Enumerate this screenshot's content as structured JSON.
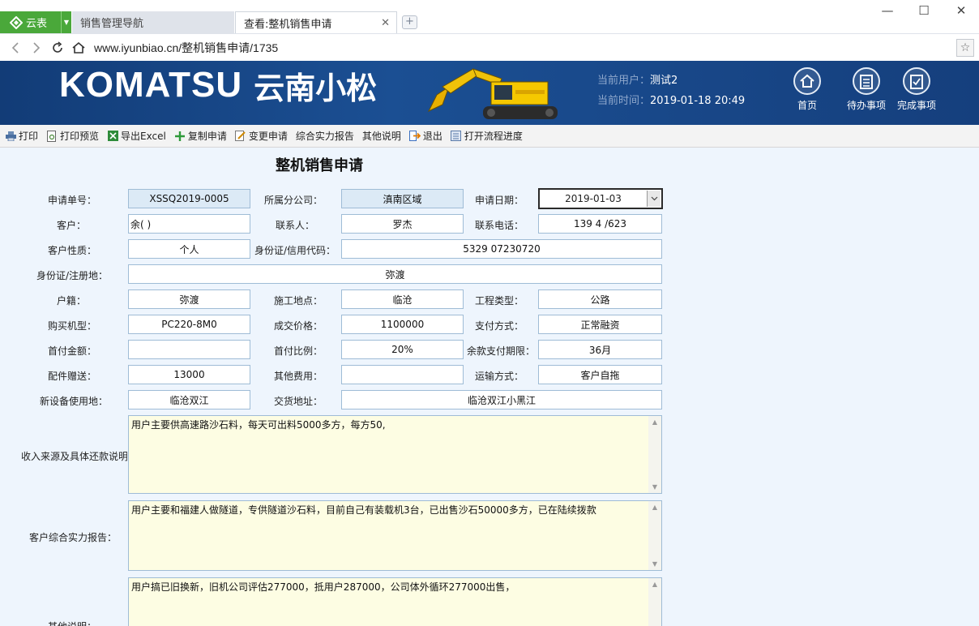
{
  "browser": {
    "app_tab_label": "云表",
    "tabs": [
      {
        "label": "销售管理导航"
      },
      {
        "label": "查看:整机销售申请"
      }
    ],
    "url": "www.iyunbiao.cn/整机销售申请/1735"
  },
  "header": {
    "brand_en": "KOMATSU",
    "brand_cn": "云南小松",
    "current_user_label": "当前用户：",
    "current_user": "测试2",
    "current_time_label": "当前时间：",
    "current_time": "2019-01-18 20:49",
    "nav": [
      {
        "label": "首页"
      },
      {
        "label": "待办事项"
      },
      {
        "label": "完成事项"
      }
    ]
  },
  "toolbar": {
    "print": "打印",
    "print_preview": "打印预览",
    "export_excel": "导出Excel",
    "copy_request": "复制申请",
    "change_request": "变更申请",
    "strength_report": "综合实力报告",
    "other_notes": "其他说明",
    "exit": "退出",
    "open_progress": "打开流程进度"
  },
  "form": {
    "title": "整机销售申请",
    "labels": {
      "request_no": "申请单号：",
      "branch": "所属分公司：",
      "request_date": "申请日期：",
      "customer": "客户：",
      "contact": "联系人：",
      "phone": "联系电话：",
      "customer_type": "客户性质：",
      "id_code": "身份证/信用代码：",
      "reg_addr": "身份证/注册地：",
      "household": "户籍：",
      "site": "施工地点：",
      "project_type": "工程类型：",
      "model": "购买机型：",
      "price": "成交价格：",
      "payment": "支付方式：",
      "down_amount": "首付金额：",
      "down_ratio": "首付比例：",
      "balance_term": "余款支付期限：",
      "parts_gift": "配件赠送：",
      "other_fee": "其他费用：",
      "transport": "运输方式：",
      "use_place": "新设备使用地：",
      "delivery": "交货地址：",
      "income_desc": "收入来源及具体还款说明",
      "strength": "客户综合实力报告：",
      "other": "其他说明："
    },
    "values": {
      "request_no": "XSSQ2019-0005",
      "branch": "滇南区域",
      "request_date": "2019-01-03",
      "customer": "余(   )",
      "contact": "罗杰",
      "phone": "139      4 /623",
      "customer_type": "个人",
      "id_code": "5329             07230720",
      "reg_addr": "弥渡",
      "household": "弥渡",
      "site": "临沧",
      "project_type": "公路",
      "model": "PC220-8M0",
      "price": "1100000",
      "payment": "正常融资",
      "down_amount": "",
      "down_ratio": "20%",
      "balance_term": "36月",
      "parts_gift": "13000",
      "other_fee": "",
      "transport": "客户自拖",
      "use_place": "临沧双江",
      "delivery": "临沧双江小黑江",
      "income_desc": "用户主要供高速路沙石料，每天可出料5000多方，每方50,",
      "strength": "用户主要和福建人做隧道，专供隧道沙石料，目前自己有装载机3台，已出售沙石50000多方，已在陆续拨款",
      "other": "用户搞已旧换新，旧机公司评估277000，抵用户287000，公司体外循环277000出售，"
    }
  }
}
